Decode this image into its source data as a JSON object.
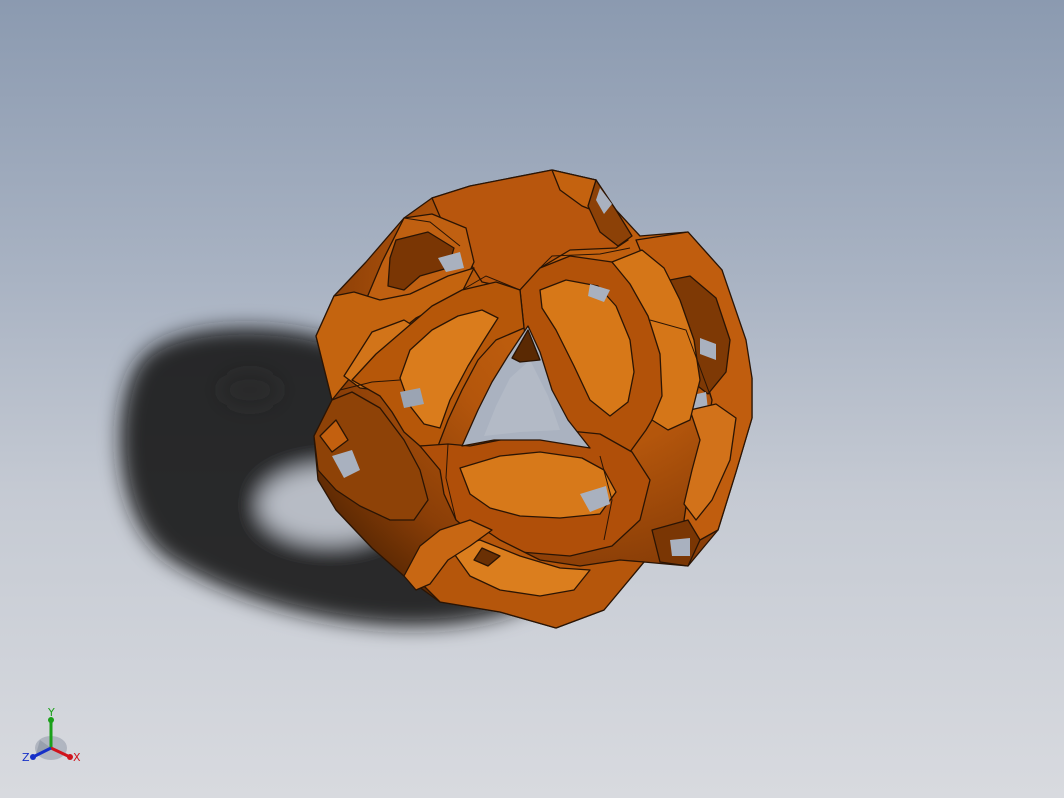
{
  "viewport": {
    "background_top": "#8b9ab0",
    "background_bottom": "#d8dadf"
  },
  "model": {
    "shape": "interlocked-loops-sphere",
    "color": "#b8560f",
    "edge_color": "#2a1404",
    "shadow_color": "#1e1e1e"
  },
  "triad": {
    "x_label": "X",
    "y_label": "Y",
    "z_label": "Z",
    "x_color": "#d0141c",
    "y_color": "#1aa01a",
    "z_color": "#1630c8"
  }
}
